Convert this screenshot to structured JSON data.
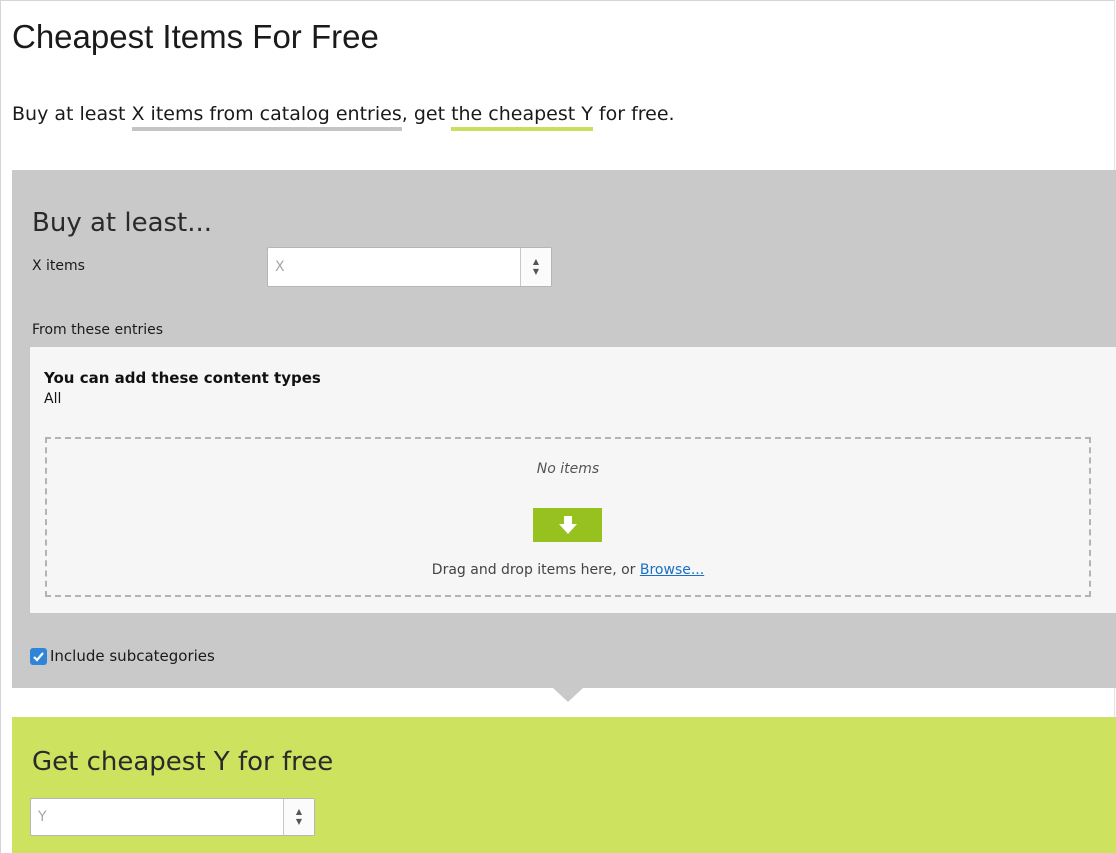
{
  "page": {
    "title": "Cheapest Items For Free",
    "summary": {
      "prefix": "Buy at least ",
      "x_phrase": "X items from catalog entries",
      "middle": ", get ",
      "y_phrase": "the cheapest Y",
      "suffix": " for free."
    }
  },
  "buy_section": {
    "title": "Buy at least...",
    "x_items_label": "X items",
    "x_placeholder": "X",
    "entries_label": "From these entries",
    "content_types_title": "You can add these content types",
    "content_types_value": "All",
    "dropzone": {
      "empty_text": "No items",
      "instruction": "Drag and drop items here, or ",
      "browse_link": "Browse..."
    },
    "include_subcategories_label": "Include subcategories",
    "include_subcategories_checked": true
  },
  "get_section": {
    "title": "Get cheapest Y for free",
    "y_placeholder": "Y"
  },
  "colors": {
    "buy_bg": "#c8c9c8",
    "get_bg": "#cde35f",
    "x_underline": "#c3c5c4",
    "y_underline": "#c9df5e",
    "drop_icon": "#97c11f",
    "checkbox": "#2f86d8",
    "link": "#1a6fc6"
  },
  "icons": {
    "drop": "arrow-down-icon",
    "spinner_up": "caret-up-icon",
    "spinner_down": "caret-down-icon",
    "checkbox": "checkmark-icon"
  }
}
